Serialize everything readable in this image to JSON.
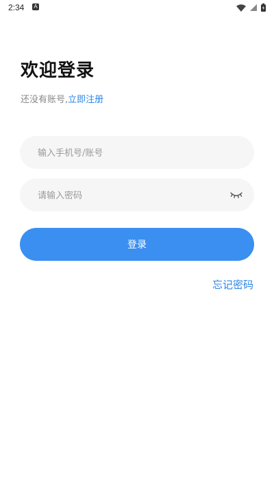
{
  "status_bar": {
    "time": "2:34",
    "notification_glyph": "A",
    "icons": [
      "wifi-icon",
      "signal-icon",
      "battery-icon"
    ]
  },
  "header": {
    "title": "欢迎登录",
    "subtitle_prefix": "还没有账号,",
    "register_link": "立即注册"
  },
  "form": {
    "account_placeholder": "输入手机号/账号",
    "account_value": "",
    "password_placeholder": "请输入密码",
    "password_value": "",
    "password_toggle_icon": "eye-closed-icon",
    "login_label": "登录",
    "forgot_label": "忘记密码"
  },
  "colors": {
    "accent": "#3a8ff0",
    "link": "#2c86e6",
    "field_bg": "#f6f6f6",
    "title_text": "#111111",
    "muted_text": "#888888"
  }
}
